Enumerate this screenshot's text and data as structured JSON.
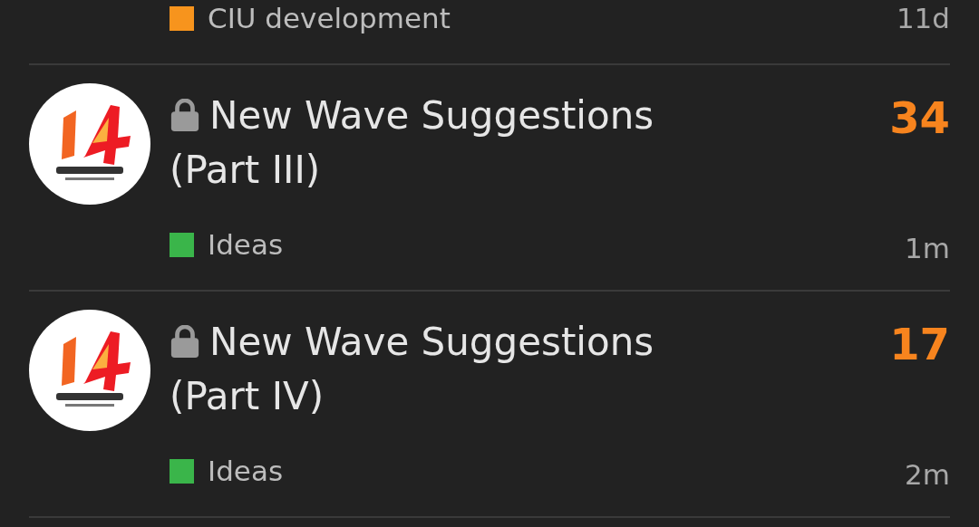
{
  "topics": [
    {
      "category": "CIU development",
      "color": "#f7941d",
      "time": "11d"
    },
    {
      "locked": true,
      "title": "New Wave Suggestions (Part III)",
      "count": "34",
      "category": "Ideas",
      "color": "#3ab54a",
      "time": "1m"
    },
    {
      "locked": true,
      "title": "New Wave Suggestions (Part IV)",
      "count": "17",
      "category": "Ideas",
      "color": "#3ab54a",
      "time": "2m"
    }
  ]
}
